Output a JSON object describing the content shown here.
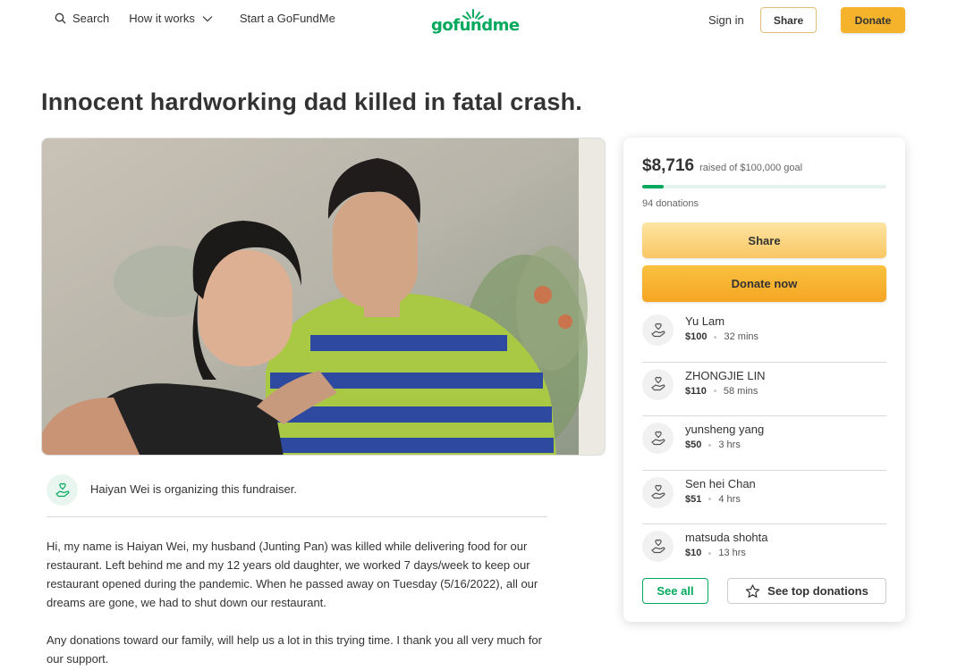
{
  "header": {
    "search_label": "Search",
    "how_it_works_label": "How it works",
    "start_label": "Start a GoFundMe",
    "logo_text": "gofundme",
    "signin_label": "Sign in",
    "share_label": "Share",
    "donate_label": "Donate"
  },
  "campaign": {
    "title": "Innocent hardworking dad killed in fatal crash.",
    "organizer_text": "Haiyan Wei is organizing this fundraiser.",
    "story": [
      "Hi, my name is Haiyan Wei, my husband (Junting Pan) was killed while delivering food for our restaurant. Left behind me and my 12 years old daughter, we worked 7 days/week to keep our restaurant opened during the pandemic. When he passed away on Tuesday (5/16/2022), all our dreams are gone, we had to shut down our restaurant.",
      "Any donations toward our family, will help us a lot in this trying time. I thank you all very much for our support."
    ]
  },
  "sidebar": {
    "raised_amount": "$8,716",
    "raised_goal_text": "raised of $100,000 goal",
    "progress_fraction": 0.087,
    "donations_count_text": "94 donations",
    "share_label": "Share",
    "donate_now_label": "Donate now",
    "donors": [
      {
        "name": "Yu Lam",
        "amount": "$100",
        "time": "32 mins"
      },
      {
        "name": "ZHONGJIE LIN",
        "amount": "$110",
        "time": "58 mins"
      },
      {
        "name": "yunsheng yang",
        "amount": "$50",
        "time": "3 hrs"
      },
      {
        "name": "Sen hei Chan",
        "amount": "$51",
        "time": "4 hrs"
      },
      {
        "name": "matsuda shohta",
        "amount": "$10",
        "time": "13 hrs"
      }
    ],
    "see_all_label": "See all",
    "see_top_label": "See top donations"
  },
  "colors": {
    "brand_green": "#02a95c",
    "donate_orange": "#f5a623",
    "share_yellow": "#f9c764"
  },
  "icons": [
    "search-icon",
    "chevron-down-icon",
    "logo-sun-icon",
    "hand-heart-icon",
    "star-icon"
  ]
}
